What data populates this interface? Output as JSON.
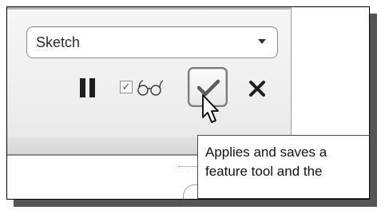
{
  "dashboard": {
    "selector": {
      "selected_value": "Sketch"
    },
    "toolbar": {
      "pause_icon": "pause-icon",
      "preview_checkbox": {
        "checked": true,
        "glyph": "✓"
      },
      "preview_icon": "glasses-icon",
      "apply_icon": "checkmark-icon",
      "cancel_icon": "x-icon"
    }
  },
  "tooltip": {
    "line1": "Applies and saves a",
    "line2": "feature tool and the"
  },
  "colors": {
    "panel_bg": "#eeeeee",
    "accent_check": "#5c5c5c",
    "icon_dark": "#1e1e1e"
  }
}
